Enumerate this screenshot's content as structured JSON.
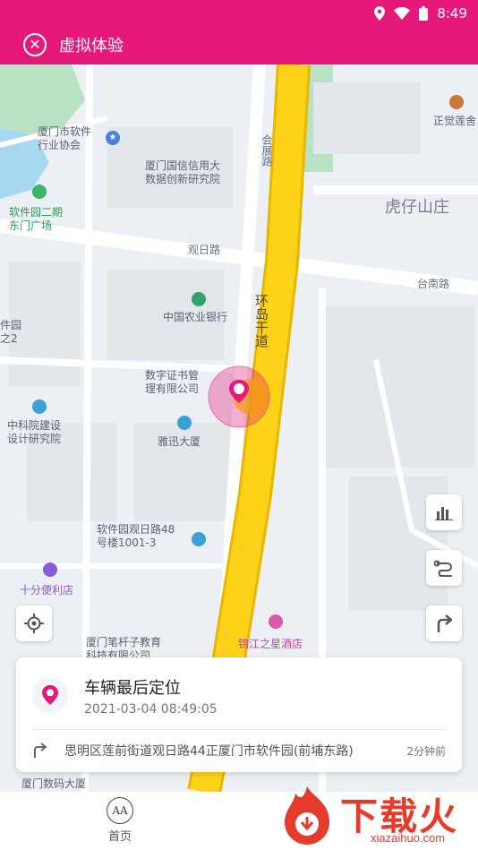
{
  "status": {
    "time": "8:49"
  },
  "header": {
    "title": "虚拟体验",
    "close_icon": "close-circle-icon",
    "bg_color": "#e6197a"
  },
  "map": {
    "labels": {
      "xiamen_software": "厦门市软件\n行业协会",
      "guoxin": "厦门国信信用大\n数据创新研究院",
      "park_gate": "软件园二期\n东门广场",
      "huziashan": "虎仔山庄",
      "zhengjue": "正觉莲舍",
      "abc_bank": "中国农业银行",
      "shuzi_cert": "数字证书管\n理有限公司",
      "zhongke": "中科院建设\n设计研究院",
      "yaxun": "雅迅大厦",
      "guanri48": "软件园观日路48\n号楼1001-3",
      "shifen": "十分便利店",
      "bigan": "厦门笔杆子教育\n科技有限公司",
      "jinjiang": "锦江之星酒店",
      "left_edge": "件园\n之2",
      "bottom_left": "厦门数码大厦"
    },
    "roads": {
      "huizhan": "会展路",
      "guanri": "观日路",
      "huandao": "环岛干道",
      "tainan": "台南路"
    }
  },
  "card": {
    "title": "车辆最后定位",
    "time": "2021-03-04 08:49:05",
    "address": "思明区莲前街道观日路44正厦门市软件园(前埔东路)",
    "ago": "2分钟前"
  },
  "nav": {
    "home_label": "首页"
  },
  "watermark": {
    "text": "下载火",
    "url": "xiazaihuo.com"
  }
}
